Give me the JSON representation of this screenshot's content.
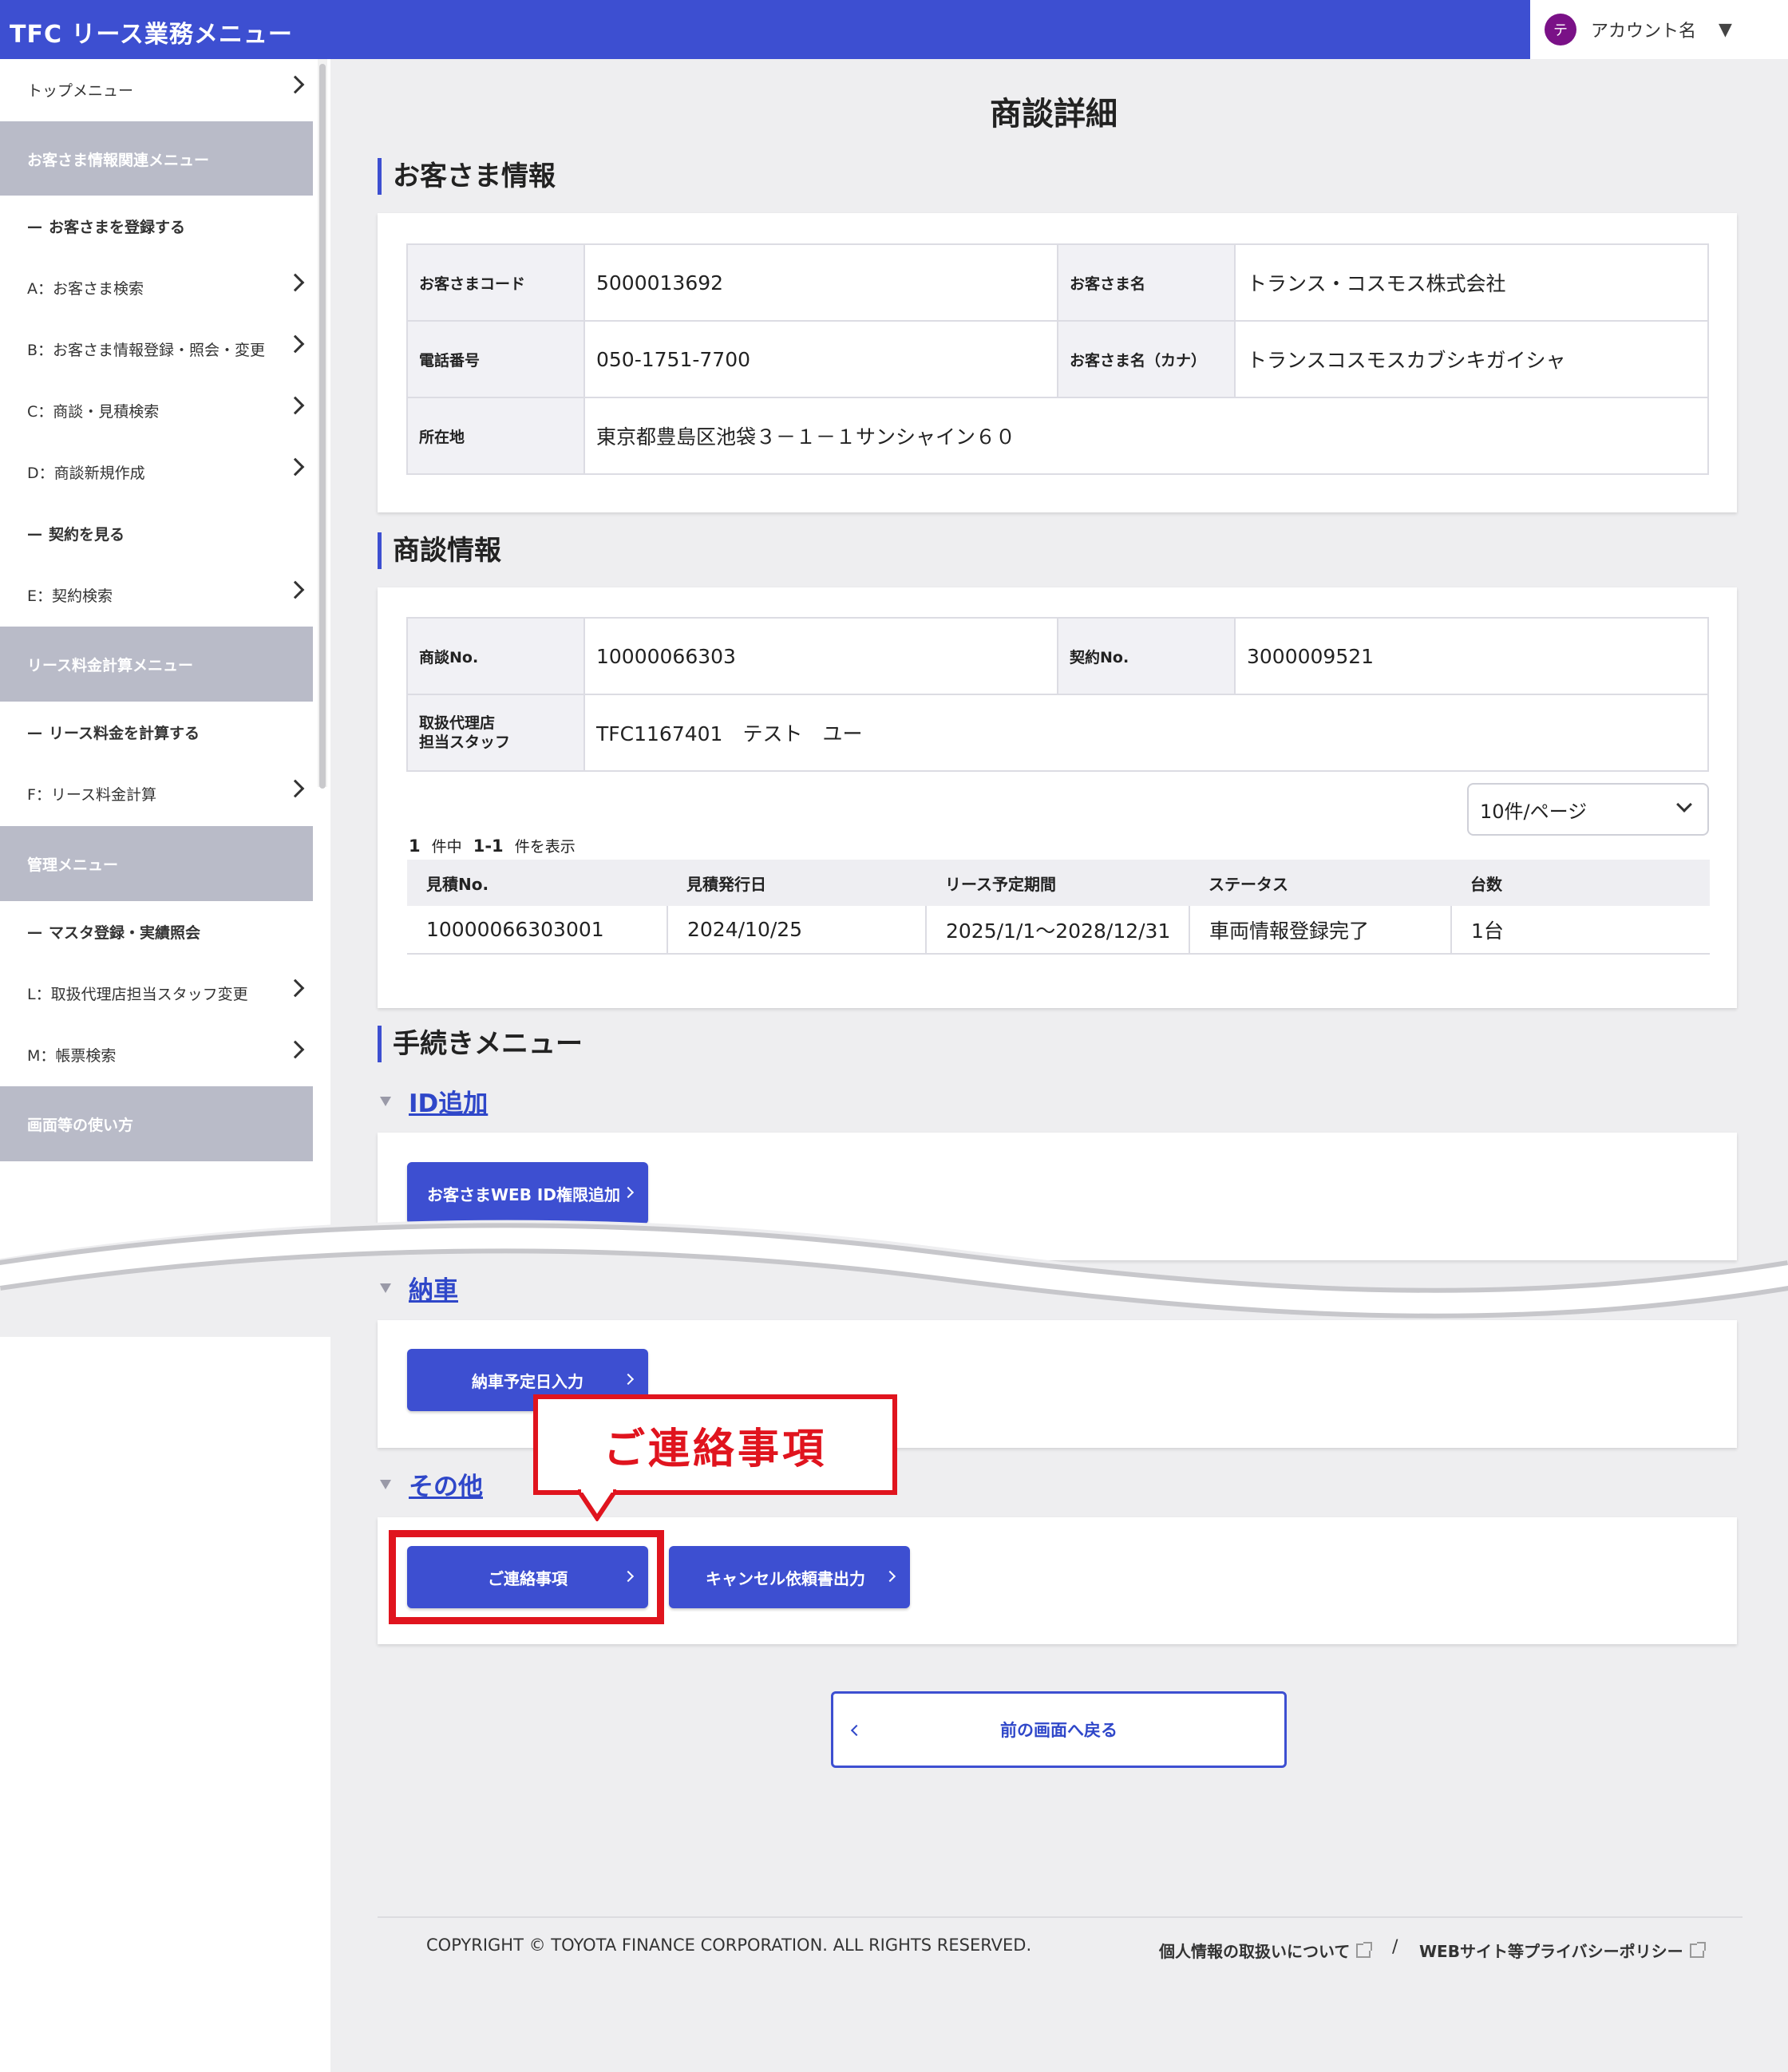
{
  "header": {
    "app_title": "TFC リース業務メニュー",
    "account_initial": "テ",
    "account_name": "アカウント名",
    "account_caret": "▼"
  },
  "sidebar": {
    "top_menu": "トップメニュー",
    "customer_menu_head": "お客さま情報関連メニュー",
    "register_customer": "お客さまを登録する",
    "customer_search": "A：お客さま検索",
    "customer_register_change": "B：お客さま情報登録・照会・変更",
    "deal_search": "C：商談・見積検索",
    "new_deal": "D：商談新規作成",
    "view_contract": "契約を見る",
    "contract_search": "E：契約検索",
    "lease_menu_head": "リース料金計算メニュー",
    "calc_lease": "リース料金を計算する",
    "lease_calc": "F：リース料金計算",
    "admin_menu_head": "管理メニュー",
    "master_reg": "マスタ登録・実績照会",
    "staff_change": "L：取扱代理店担当スタッフ変更",
    "form_search": "M：帳票検索",
    "howto_head": "画面等の使い方"
  },
  "page_title": "商談詳細",
  "customer_section": {
    "title": "お客さま情報",
    "code_label": "お客さまコード",
    "code": "5000013692",
    "name_label": "お客さま名",
    "name": "トランス・コスモス株式会社",
    "phone_label": "電話番号",
    "phone": "050-1751-7700",
    "kana_label": "お客さま名（カナ）",
    "kana": "トランスコスモスカブシキガイシャ",
    "address_label": "所在地",
    "address": "東京都豊島区池袋３－１－１サンシャイン６０"
  },
  "deal_section": {
    "title": "商談情報",
    "deal_no_label": "商談No.",
    "deal_no": "10000066303",
    "contract_no_label": "契約No.",
    "contract_no": "3000009521",
    "staff_label_1": "取扱代理店",
    "staff_label_2": "担当スタッフ",
    "staff": "TFC1167401　テスト　ユー",
    "per_page": "10件/ページ",
    "count_total": "1",
    "count_mid": "件中",
    "count_range": "1-1",
    "count_suffix": "件を表示",
    "table_headers": [
      "見積No.",
      "見積発行日",
      "リース予定期間",
      "ステータス",
      "台数"
    ],
    "table_rows": [
      [
        "10000066303001",
        "2024/10/25",
        "2025/1/1〜2028/12/31",
        "車両情報登録完了",
        "1台"
      ]
    ]
  },
  "procedure_section": {
    "title": "手続きメニュー",
    "id_add_head": "ID追加",
    "web_id_button": "お客さまWEB ID権限追加",
    "delivery_head": "納車",
    "delivery_date_button": "納車予定日入力",
    "other_head": "その他",
    "contact_button": "ご連絡事項",
    "cancel_button": "キャンセル依頼書出力"
  },
  "back_button": "前の画面へ戻る",
  "footer": {
    "copyright": "COPYRIGHT © TOYOTA FINANCE CORPORATION. ALL RIGHTS RESERVED.",
    "privacy_link": "個人情報の取扱いについて",
    "separator": "/",
    "web_policy_link": "WEBサイト等プライバシーポリシー"
  },
  "annotation": {
    "callout_text": "ご連絡事項"
  },
  "colors": {
    "accent": "#3d4fd1",
    "highlight": "#e0141e",
    "sidebar_head": "#b9bbc8"
  }
}
